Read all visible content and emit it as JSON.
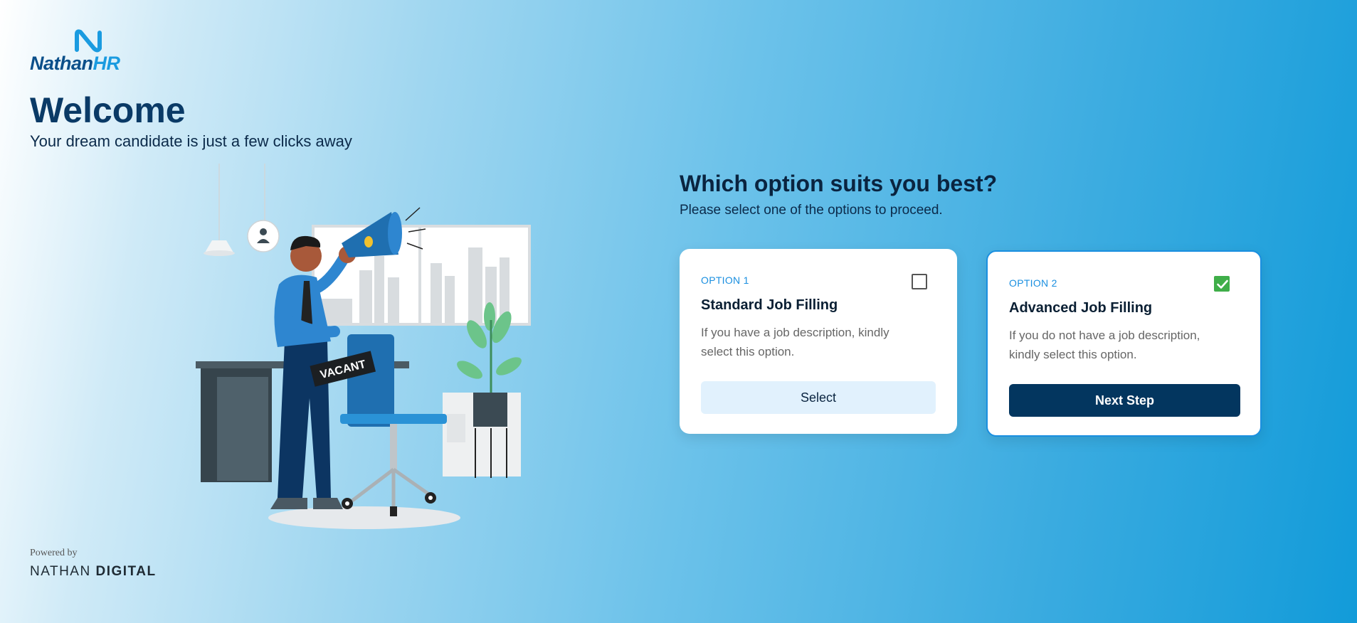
{
  "brand": {
    "name_part1": "Nathan",
    "name_part2": "HR",
    "color": "#0b4f8a",
    "accent": "#1a9be0"
  },
  "hero": {
    "title": "Welcome",
    "subtitle": "Your dream candidate is just a few clicks away",
    "illustration_sign": "VACANT"
  },
  "footer": {
    "powered_by": "Powered by",
    "company_part1": "NATHAN ",
    "company_part2": "DIGITAL"
  },
  "selection": {
    "question": "Which option suits you best?",
    "instruction": "Please select one of the options to proceed.",
    "options": [
      {
        "tag": "OPTION 1",
        "title": "Standard Job Filling",
        "description": "If you have a job description, kindly select this option.",
        "checked": false,
        "button_label": "Select"
      },
      {
        "tag": "OPTION 2",
        "title": "Advanced Job Filling",
        "description": "If you do not have a job description, kindly select this option.",
        "checked": true,
        "button_label": "Next Step"
      }
    ]
  },
  "colors": {
    "primary_button": "#03365f",
    "secondary_button": "#e1f1fd",
    "check_green": "#3fae49",
    "selected_border": "#1a8fe0"
  }
}
